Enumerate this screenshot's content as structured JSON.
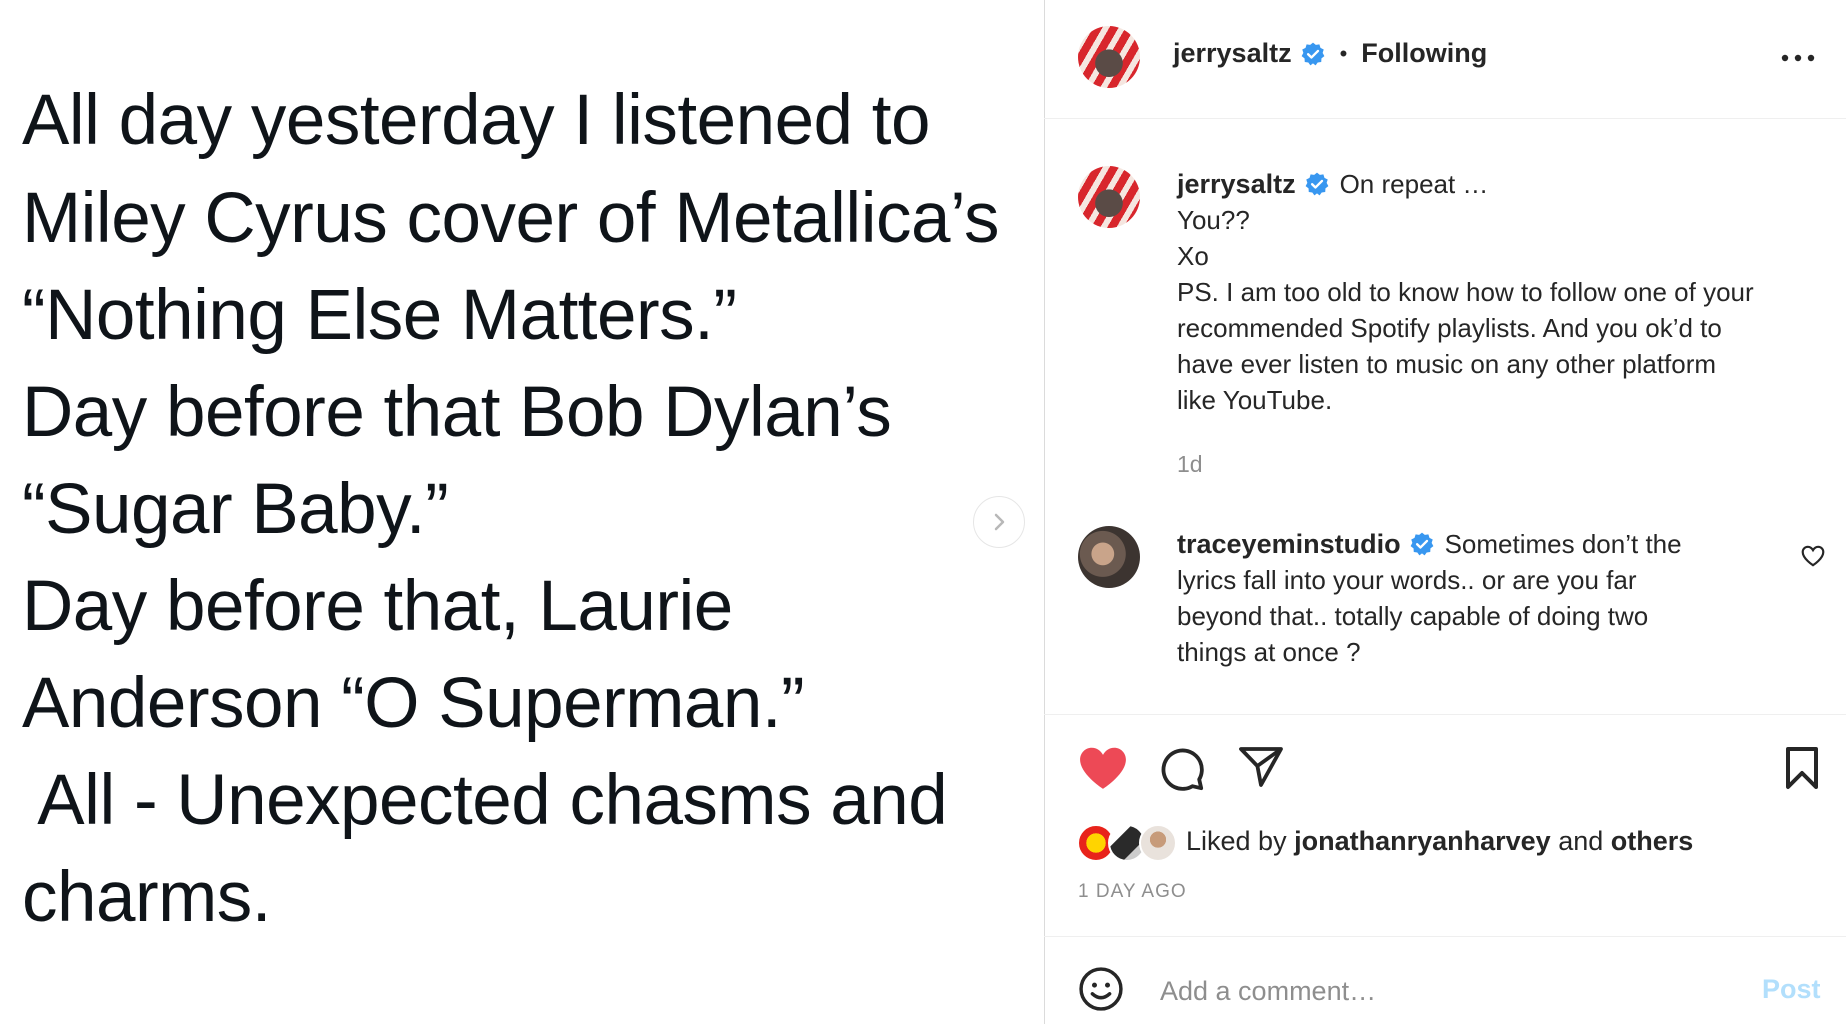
{
  "post_image": {
    "lines": [
      "All day yesterday I listened to",
      "Miley Cyrus cover of Metallica’s",
      "“Nothing Else Matters.”",
      "Day before that Bob Dylan’s",
      "“Sugar Baby.”",
      "Day before that, Laurie",
      "Anderson “O Superman.”",
      " All - Unexpected chasms and",
      "charms."
    ]
  },
  "header": {
    "username": "jerrysaltz",
    "separator": "•",
    "follow_status": "Following",
    "more_icon": "more-horizontal-icon"
  },
  "caption": {
    "username": "jerrysaltz",
    "first_line": "On repeat …",
    "lines": [
      "You??",
      "Xo",
      "PS. I am too old to know how to follow one of your",
      "recommended Spotify playlists. And you ok’d to",
      "have ever listen to music on any other platform",
      "like YouTube."
    ],
    "time": "1d"
  },
  "comment": {
    "username": "traceyeminstudio",
    "first_line": "Sometimes don’t the",
    "lines": [
      "lyrics fall into your words.. or are you far",
      "beyond that.. totally capable of doing two",
      "things at once ?"
    ]
  },
  "actions": {
    "liked_prefix": "Liked by",
    "liked_user": "jonathanryanharvey",
    "liked_and": "and",
    "liked_others": "others",
    "timestamp": "1 DAY AGO"
  },
  "comment_box": {
    "placeholder": "Add a comment…",
    "post_label": "Post"
  },
  "colors": {
    "like_red": "#ed4956",
    "verified_blue": "#3897f0",
    "post_disabled": "#b2dffc"
  }
}
